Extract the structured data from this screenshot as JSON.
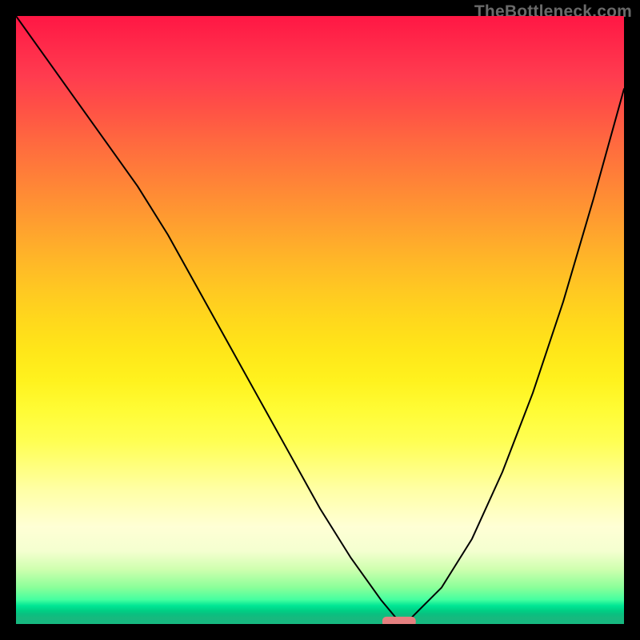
{
  "watermark": "TheBottleneck.com",
  "chart_data": {
    "type": "line",
    "title": "",
    "xlabel": "",
    "ylabel": "",
    "xlim": [
      0,
      100
    ],
    "ylim": [
      0,
      100
    ],
    "legend": false,
    "background": "rainbow-gradient-red-to-green",
    "series": [
      {
        "name": "bottleneck-curve",
        "x": [
          0,
          5,
          10,
          15,
          20,
          25,
          30,
          35,
          40,
          45,
          50,
          55,
          60,
          62.5,
          63.5,
          65,
          70,
          75,
          80,
          85,
          90,
          95,
          100
        ],
        "y": [
          100,
          93,
          86,
          79,
          72,
          64,
          55,
          46,
          37,
          28,
          19,
          11,
          4,
          1,
          0,
          1,
          6,
          14,
          25,
          38,
          53,
          70,
          88
        ],
        "color": "#000000",
        "stroke_width": 2
      }
    ],
    "marker": {
      "name": "optimal-point",
      "x": 63,
      "y": 0,
      "shape": "rounded-rect",
      "color": "#e58080",
      "width_pct": 5.5,
      "height_pct": 1.6
    }
  }
}
